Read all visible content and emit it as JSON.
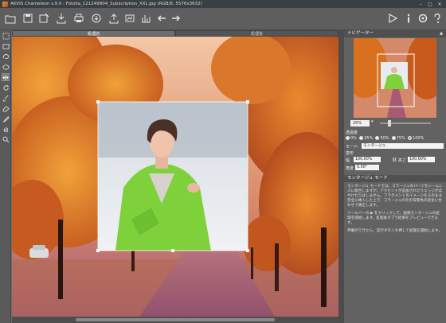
{
  "window": {
    "title": "AKVIS Chameleon v.9.0 - Fotolia_121249904_Subscription_XXL.jpg (RGB/8, 5576x3632)",
    "controls": [
      "–",
      "▢",
      "✕"
    ]
  },
  "toolbar": {
    "left_icons": [
      "open-file-icon",
      "save-file-icon",
      "save-as-icon",
      "print-icon",
      "share-icon",
      "import-icon",
      "export-icon",
      "batch-icon",
      "undo-icon",
      "redo-icon"
    ],
    "right_icons": [
      "run-icon",
      "info-icon",
      "settings-icon",
      "help-icon"
    ]
  },
  "tools": [
    "selection-icon",
    "rect-select-icon",
    "ellipse-select-icon",
    "lasso-icon",
    "transform-icon",
    "brush-icon",
    "eraser-icon",
    "eyedropper-icon",
    "stamp-icon",
    "hand-icon",
    "zoom-icon"
  ],
  "tabs": {
    "before": "処理前",
    "after": "処理後"
  },
  "navigator": {
    "title": "ナビゲーター",
    "zoom": "25%"
  },
  "settings": {
    "opacity_label": "透過度",
    "opacity_options": [
      "0%",
      "25%",
      "50%",
      "75%",
      "100%"
    ],
    "mode_label": "モード:",
    "mode_value": "モンタージュ",
    "transform_label": "変形",
    "width_label": "幅",
    "width_value": "100.00%",
    "height_label": "高さ",
    "height_value": "100.00%",
    "angle_label": "角度",
    "angle_value": "0.00°"
  },
  "help": {
    "title": "モンタージュ モード",
    "paragraphs": [
      "モンタージュ モードでは、コラージュのパーツをシームレスに統合しますが、アクセントが追加されたりエッジがぼやけたりはしません。フラグメントのイメージをそのまま完全に挿入した上で、コラージュの元の背景色の変化に合わせて補正します。",
      "ツールバーの ▶ をクリックして、画像モンタージュの処理を開始します。処理後タブで結果をプレビューできます。",
      "準備ができたら、実行ボタンを押して処理を開始します。"
    ]
  },
  "colors": {
    "toolbar_bg": "#5e5e5e",
    "panel_bg": "#626262",
    "accent_green": "#7fd13b"
  }
}
